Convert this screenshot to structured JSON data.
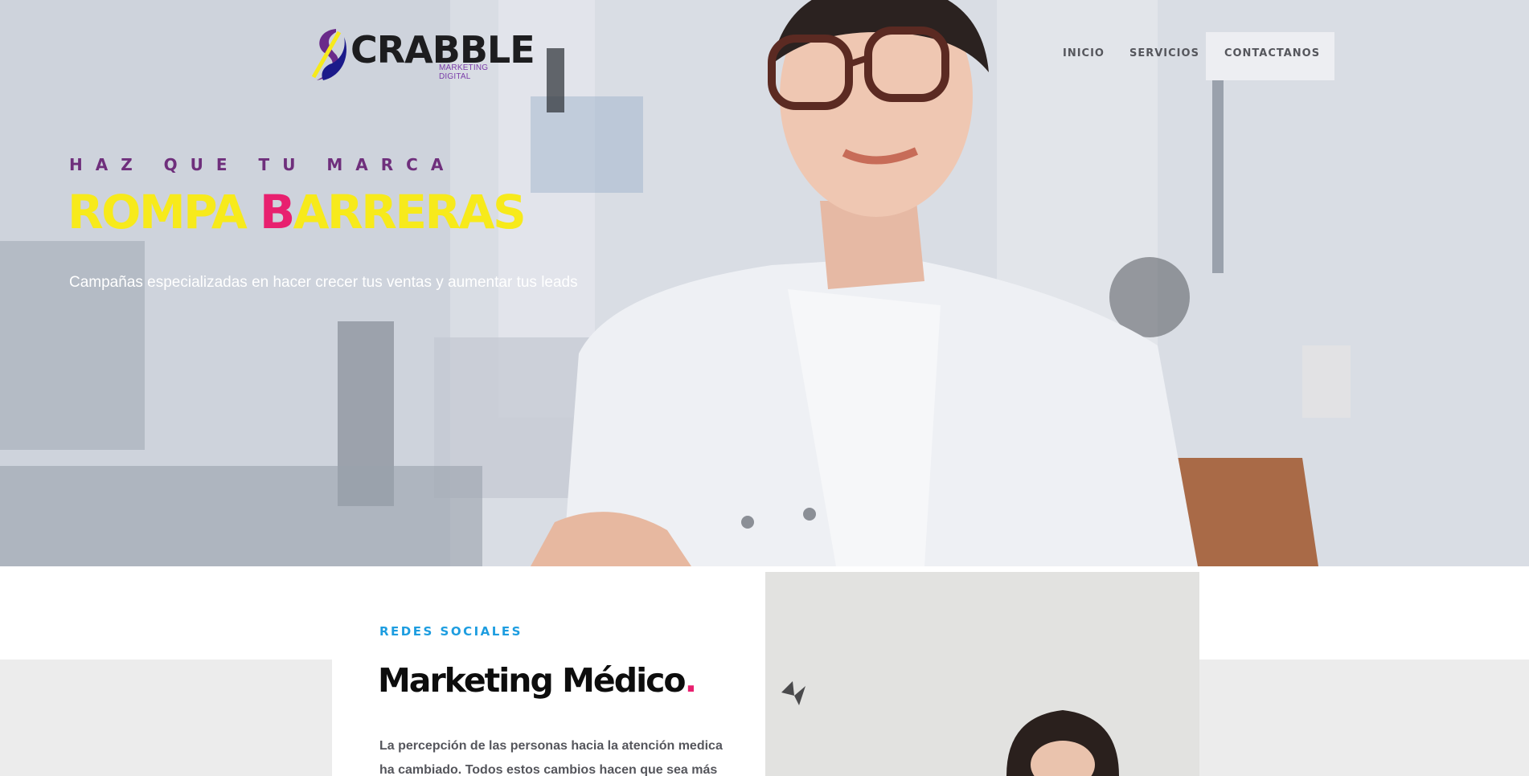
{
  "header": {
    "logo_text": "CRABBLE",
    "logo_subtitle": "MARKETING DIGITAL",
    "nav": [
      {
        "label": "INICIO"
      },
      {
        "label": "SERVICIOS"
      },
      {
        "label": "CONTACTANOS"
      }
    ]
  },
  "hero": {
    "kicker": "HAZ QUE TU MARCA",
    "headline_part1": "ROMPA ",
    "headline_highlight": "B",
    "headline_part2": "ARRERAS",
    "subtitle": "Campañas especializadas en hacer crecer tus ventas y aumentar tus leads"
  },
  "section": {
    "kicker": "REDES SOCIALES",
    "title": "Marketing Médico",
    "title_dot": ".",
    "body": "La percepción de las personas hacia la atención medica ha cambiado. Todos estos cambios hacen que sea más"
  },
  "colors": {
    "accent_yellow": "#f7ea1b",
    "accent_pink": "#e8206f",
    "accent_purple": "#6f2f7c",
    "accent_blue": "#1d9de0"
  }
}
